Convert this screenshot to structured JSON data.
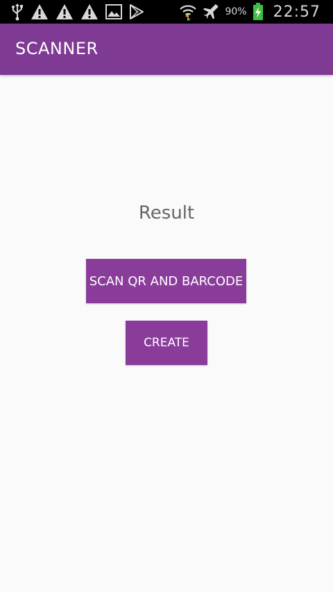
{
  "status_bar": {
    "left_icons": [
      "usb-icon",
      "warning-icon",
      "warning-icon",
      "warning-icon",
      "image-icon",
      "play-store-icon"
    ],
    "right_icons": [
      "wifi-icon",
      "airplane-mode-icon",
      "battery-charging-icon"
    ],
    "battery_percent": "90%",
    "time": "22:57"
  },
  "app_bar": {
    "title": "SCANNER",
    "color": "#7f3a93"
  },
  "main": {
    "result_label": "Result",
    "scan_button_label": "SCAN QR AND BARCODE",
    "create_button_label": "CREATE",
    "button_color": "#8a3c9b"
  }
}
